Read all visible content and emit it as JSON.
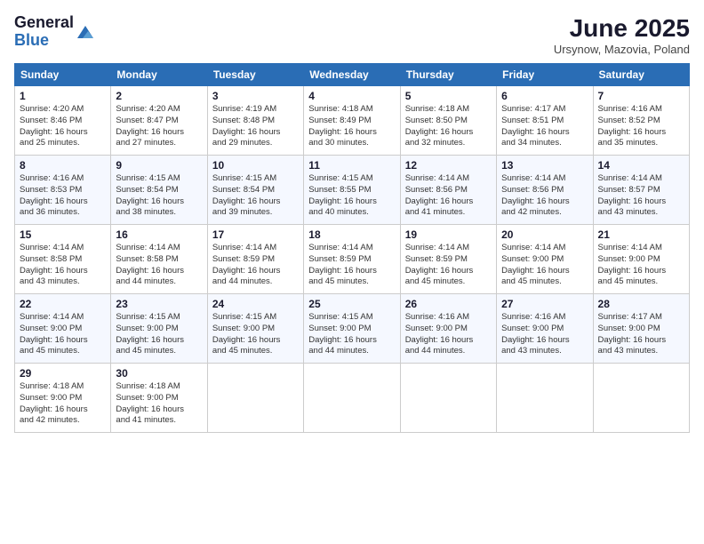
{
  "logo": {
    "general": "General",
    "blue": "Blue"
  },
  "title": "June 2025",
  "subtitle": "Ursynow, Mazovia, Poland",
  "headers": [
    "Sunday",
    "Monday",
    "Tuesday",
    "Wednesday",
    "Thursday",
    "Friday",
    "Saturday"
  ],
  "weeks": [
    [
      {
        "day": "1",
        "info": "Sunrise: 4:20 AM\nSunset: 8:46 PM\nDaylight: 16 hours\nand 25 minutes."
      },
      {
        "day": "2",
        "info": "Sunrise: 4:20 AM\nSunset: 8:47 PM\nDaylight: 16 hours\nand 27 minutes."
      },
      {
        "day": "3",
        "info": "Sunrise: 4:19 AM\nSunset: 8:48 PM\nDaylight: 16 hours\nand 29 minutes."
      },
      {
        "day": "4",
        "info": "Sunrise: 4:18 AM\nSunset: 8:49 PM\nDaylight: 16 hours\nand 30 minutes."
      },
      {
        "day": "5",
        "info": "Sunrise: 4:18 AM\nSunset: 8:50 PM\nDaylight: 16 hours\nand 32 minutes."
      },
      {
        "day": "6",
        "info": "Sunrise: 4:17 AM\nSunset: 8:51 PM\nDaylight: 16 hours\nand 34 minutes."
      },
      {
        "day": "7",
        "info": "Sunrise: 4:16 AM\nSunset: 8:52 PM\nDaylight: 16 hours\nand 35 minutes."
      }
    ],
    [
      {
        "day": "8",
        "info": "Sunrise: 4:16 AM\nSunset: 8:53 PM\nDaylight: 16 hours\nand 36 minutes."
      },
      {
        "day": "9",
        "info": "Sunrise: 4:15 AM\nSunset: 8:54 PM\nDaylight: 16 hours\nand 38 minutes."
      },
      {
        "day": "10",
        "info": "Sunrise: 4:15 AM\nSunset: 8:54 PM\nDaylight: 16 hours\nand 39 minutes."
      },
      {
        "day": "11",
        "info": "Sunrise: 4:15 AM\nSunset: 8:55 PM\nDaylight: 16 hours\nand 40 minutes."
      },
      {
        "day": "12",
        "info": "Sunrise: 4:14 AM\nSunset: 8:56 PM\nDaylight: 16 hours\nand 41 minutes."
      },
      {
        "day": "13",
        "info": "Sunrise: 4:14 AM\nSunset: 8:56 PM\nDaylight: 16 hours\nand 42 minutes."
      },
      {
        "day": "14",
        "info": "Sunrise: 4:14 AM\nSunset: 8:57 PM\nDaylight: 16 hours\nand 43 minutes."
      }
    ],
    [
      {
        "day": "15",
        "info": "Sunrise: 4:14 AM\nSunset: 8:58 PM\nDaylight: 16 hours\nand 43 minutes."
      },
      {
        "day": "16",
        "info": "Sunrise: 4:14 AM\nSunset: 8:58 PM\nDaylight: 16 hours\nand 44 minutes."
      },
      {
        "day": "17",
        "info": "Sunrise: 4:14 AM\nSunset: 8:59 PM\nDaylight: 16 hours\nand 44 minutes."
      },
      {
        "day": "18",
        "info": "Sunrise: 4:14 AM\nSunset: 8:59 PM\nDaylight: 16 hours\nand 45 minutes."
      },
      {
        "day": "19",
        "info": "Sunrise: 4:14 AM\nSunset: 8:59 PM\nDaylight: 16 hours\nand 45 minutes."
      },
      {
        "day": "20",
        "info": "Sunrise: 4:14 AM\nSunset: 9:00 PM\nDaylight: 16 hours\nand 45 minutes."
      },
      {
        "day": "21",
        "info": "Sunrise: 4:14 AM\nSunset: 9:00 PM\nDaylight: 16 hours\nand 45 minutes."
      }
    ],
    [
      {
        "day": "22",
        "info": "Sunrise: 4:14 AM\nSunset: 9:00 PM\nDaylight: 16 hours\nand 45 minutes."
      },
      {
        "day": "23",
        "info": "Sunrise: 4:15 AM\nSunset: 9:00 PM\nDaylight: 16 hours\nand 45 minutes."
      },
      {
        "day": "24",
        "info": "Sunrise: 4:15 AM\nSunset: 9:00 PM\nDaylight: 16 hours\nand 45 minutes."
      },
      {
        "day": "25",
        "info": "Sunrise: 4:15 AM\nSunset: 9:00 PM\nDaylight: 16 hours\nand 44 minutes."
      },
      {
        "day": "26",
        "info": "Sunrise: 4:16 AM\nSunset: 9:00 PM\nDaylight: 16 hours\nand 44 minutes."
      },
      {
        "day": "27",
        "info": "Sunrise: 4:16 AM\nSunset: 9:00 PM\nDaylight: 16 hours\nand 43 minutes."
      },
      {
        "day": "28",
        "info": "Sunrise: 4:17 AM\nSunset: 9:00 PM\nDaylight: 16 hours\nand 43 minutes."
      }
    ],
    [
      {
        "day": "29",
        "info": "Sunrise: 4:18 AM\nSunset: 9:00 PM\nDaylight: 16 hours\nand 42 minutes."
      },
      {
        "day": "30",
        "info": "Sunrise: 4:18 AM\nSunset: 9:00 PM\nDaylight: 16 hours\nand 41 minutes."
      },
      {
        "day": "",
        "info": ""
      },
      {
        "day": "",
        "info": ""
      },
      {
        "day": "",
        "info": ""
      },
      {
        "day": "",
        "info": ""
      },
      {
        "day": "",
        "info": ""
      }
    ]
  ]
}
